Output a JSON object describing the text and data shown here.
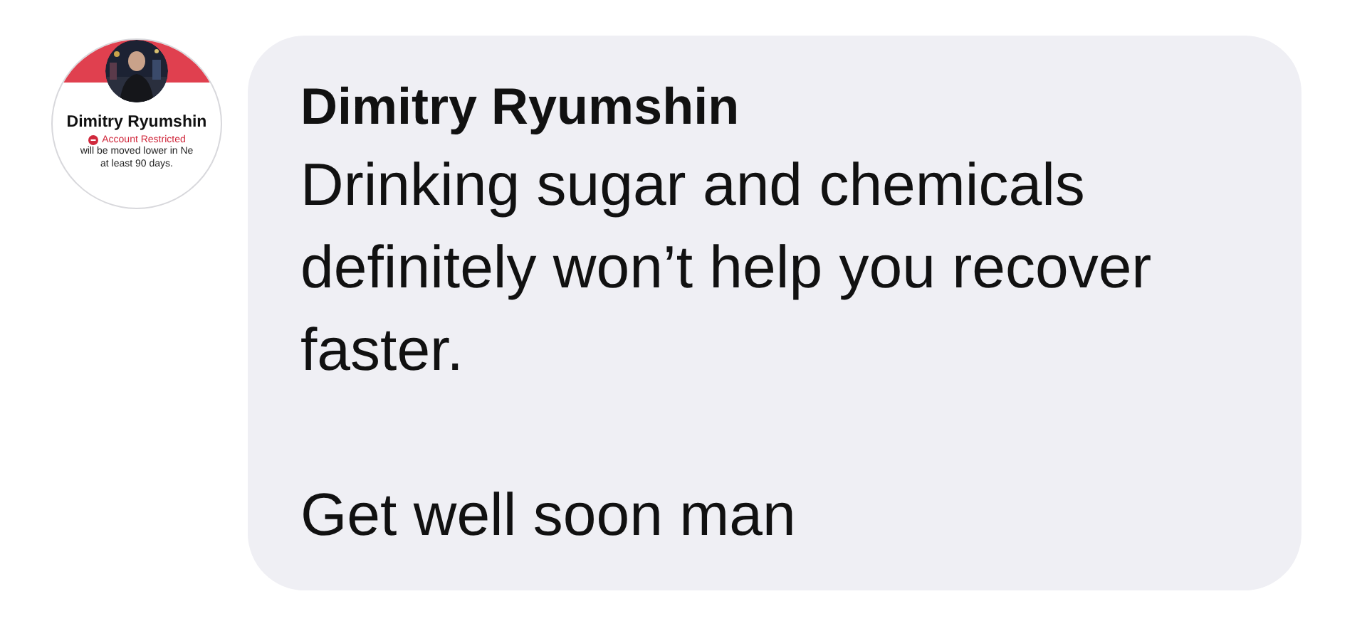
{
  "avatar": {
    "name": "Dimitry Ryumshin",
    "status": "Account Restricted",
    "notice_lines": [
      "will be moved lower in Ne",
      "at least 90 days."
    ]
  },
  "comment": {
    "author": "Dimitry Ryumshin",
    "paragraphs": [
      "Drinking sugar and chemicals definitely won’t help you recover faster.",
      "Get well soon man"
    ]
  }
}
